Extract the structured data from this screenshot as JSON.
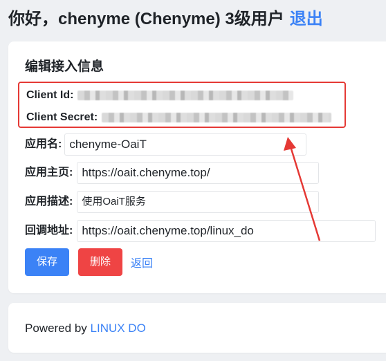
{
  "header": {
    "greeting": "你好，chenyme (Chenyme) 3级用户",
    "logout_label": "退出"
  },
  "form": {
    "title": "编辑接入信息",
    "client_id_label": "Client Id:",
    "client_secret_label": "Client Secret:",
    "name_label": "应用名:",
    "name_value": "chenyme-OaiT",
    "homepage_label": "应用主页:",
    "homepage_value": "https://oait.chenyme.top/",
    "description_label": "应用描述:",
    "description_value": "使用OaiT服务",
    "callback_label": "回调地址:",
    "callback_value": "https://oait.chenyme.top/linux_do",
    "save_label": "保存",
    "delete_label": "删除",
    "back_label": "返回"
  },
  "footer": {
    "powered_by": "Powered by",
    "brand": "LINUX DO"
  },
  "colors": {
    "accent": "#3b82f6",
    "danger": "#ef4444",
    "highlight": "#e53935",
    "background": "#eef0f3"
  }
}
